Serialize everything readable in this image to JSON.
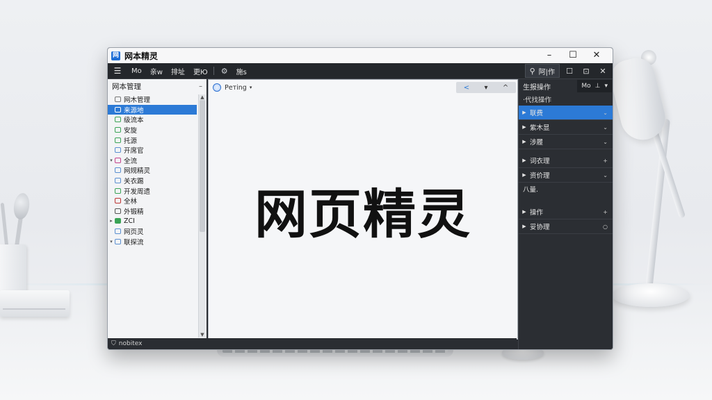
{
  "window": {
    "title": "网本精灵",
    "app_icon_glyph": "网",
    "controls": {
      "minimize": "–",
      "maximize": "☐",
      "close": "✕"
    }
  },
  "menubar": {
    "hamburger": "☰",
    "items": [
      "Mo",
      "亲w",
      "排址",
      "更Ю"
    ],
    "tool_glyph": "⚙",
    "tool_label": "施s",
    "search_label": "阿|作",
    "right_icons": [
      "☐",
      "⊡",
      "✕"
    ]
  },
  "left_panel": {
    "title": "网本管理",
    "collapse": "–",
    "tree": [
      {
        "label": "网木管理",
        "kind": "root",
        "toggle": ""
      },
      {
        "label": "来源地",
        "selected": true,
        "toggle": ""
      },
      {
        "label": "级流本",
        "toggle": ""
      },
      {
        "label": "安旋",
        "toggle": ""
      },
      {
        "label": "托源",
        "toggle": ""
      },
      {
        "label": "开席官",
        "toggle": ""
      },
      {
        "label": "全流",
        "toggle": "▾"
      },
      {
        "label": "网规精灵",
        "toggle": ""
      },
      {
        "label": "关衣踢",
        "toggle": ""
      },
      {
        "label": "开发周遗",
        "toggle": ""
      },
      {
        "label": "全林",
        "toggle": ""
      },
      {
        "label": "外锻精",
        "toggle": ""
      },
      {
        "label": "ZCI",
        "toggle": "▸"
      },
      {
        "label": "网页灵",
        "toggle": ""
      },
      {
        "label": "联探流",
        "toggle": "▾"
      }
    ],
    "status": "nobitex"
  },
  "center": {
    "browser_label": "Ретing",
    "nav": {
      "back": "<",
      "down": "▾",
      "up": "^"
    },
    "headline": "网页精灵"
  },
  "right_panel": {
    "title": "生报操作",
    "tool_labels": [
      "Mo",
      "⊥",
      "▾"
    ],
    "subtitle": "·代找操作",
    "rows": [
      {
        "label": "联费",
        "selected": true,
        "right": "⌄"
      },
      {
        "label": "紫木显",
        "right": "⌄"
      },
      {
        "label": "涉履",
        "right": "⌄"
      }
    ],
    "rows2": [
      {
        "label": "词衣理",
        "right": "+"
      },
      {
        "label": "资价理",
        "right": "⌄"
      }
    ],
    "plain": "八量.",
    "rows3": [
      {
        "label": "操作",
        "right": "+"
      },
      {
        "label": "妥协理",
        "right": "○"
      }
    ]
  }
}
